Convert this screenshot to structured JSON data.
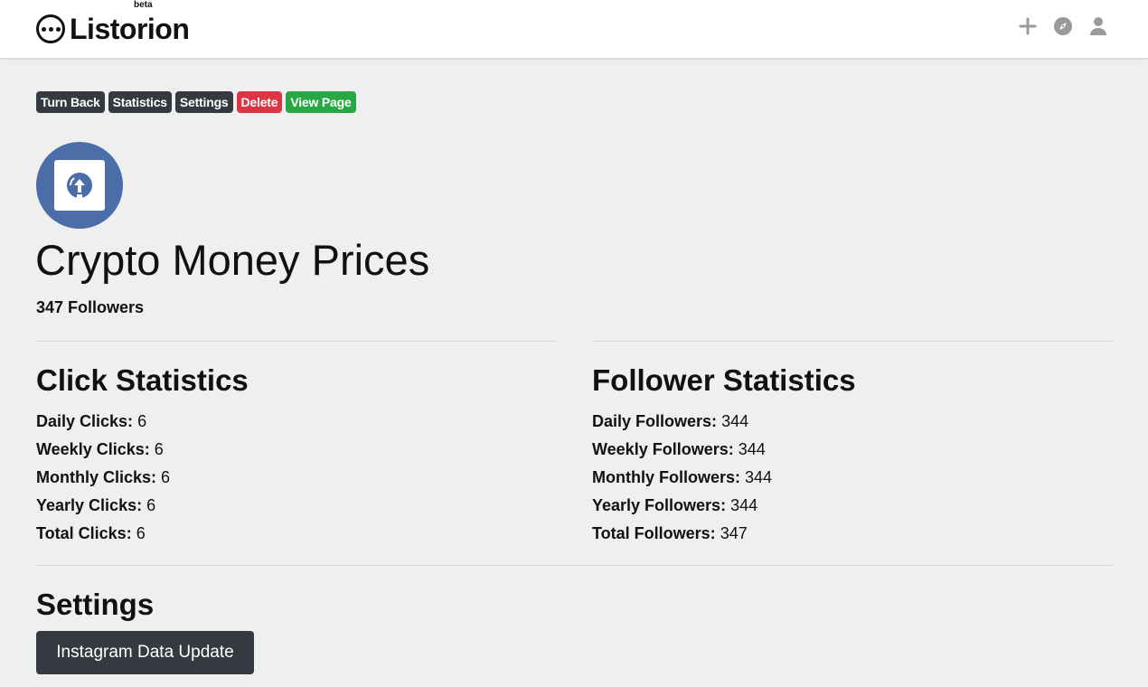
{
  "brand": {
    "name": "Listorion",
    "badge": "beta"
  },
  "header_icons": [
    "plus-icon",
    "compass-icon",
    "user-icon"
  ],
  "actions": {
    "turn_back": "Turn Back",
    "statistics": "Statistics",
    "settings": "Settings",
    "delete": "Delete",
    "view_page": "View Page"
  },
  "profile": {
    "title": "Crypto Money Prices",
    "followers": "347 Followers"
  },
  "click_stats": {
    "heading": "Click Statistics",
    "items": [
      {
        "label": "Daily Clicks:",
        "value": "6"
      },
      {
        "label": "Weekly Clicks:",
        "value": "6"
      },
      {
        "label": "Monthly Clicks:",
        "value": "6"
      },
      {
        "label": "Yearly Clicks:",
        "value": "6"
      },
      {
        "label": "Total Clicks:",
        "value": "6"
      }
    ]
  },
  "follower_stats": {
    "heading": "Follower Statistics",
    "items": [
      {
        "label": "Daily Followers:",
        "value": "344"
      },
      {
        "label": "Weekly Followers:",
        "value": "344"
      },
      {
        "label": "Monthly Followers:",
        "value": "344"
      },
      {
        "label": "Yearly Followers:",
        "value": "344"
      },
      {
        "label": "Total Followers:",
        "value": "347"
      }
    ]
  },
  "settings_section": {
    "heading": "Settings",
    "button": "Instagram Data Update"
  },
  "colors": {
    "background": "#efefef",
    "dark": "#343a40",
    "danger": "#dc3545",
    "success": "#28a745",
    "avatar": "#4b6ea9"
  }
}
